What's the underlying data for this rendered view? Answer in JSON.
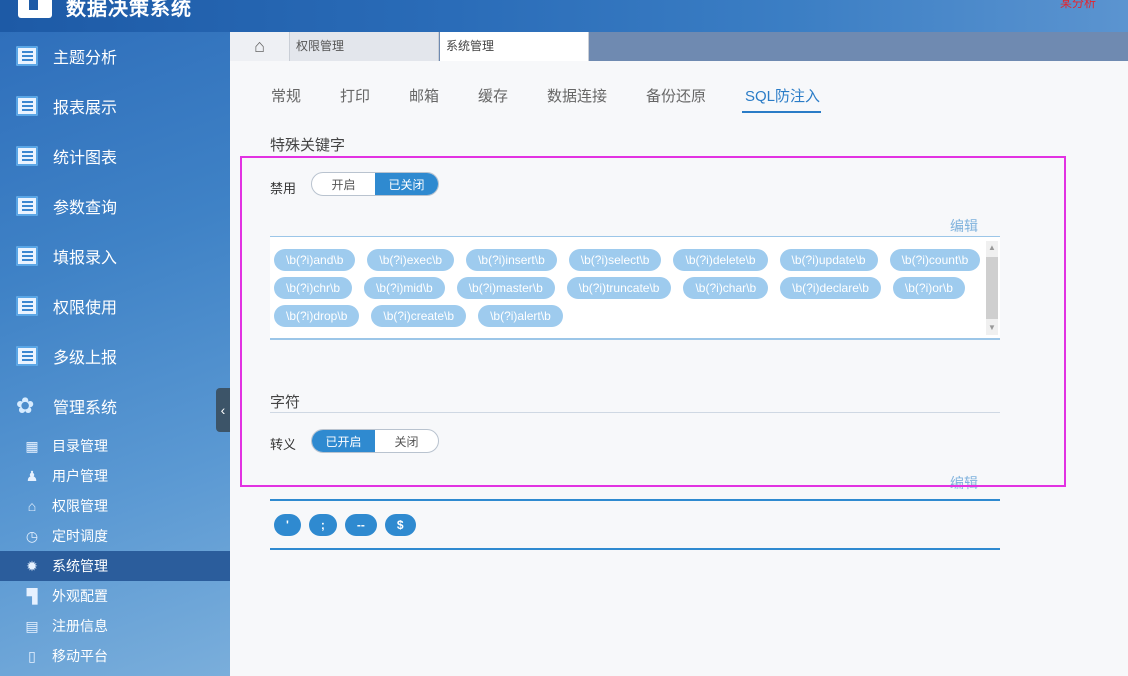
{
  "app": {
    "title": "数据决策系统",
    "user_link": "某分析"
  },
  "sidebar": {
    "items": [
      {
        "label": "主题分析",
        "icon": "report-icon"
      },
      {
        "label": "报表展示",
        "icon": "report-icon"
      },
      {
        "label": "统计图表",
        "icon": "report-icon"
      },
      {
        "label": "参数查询",
        "icon": "report-icon"
      },
      {
        "label": "填报录入",
        "icon": "report-icon"
      },
      {
        "label": "权限使用",
        "icon": "report-icon"
      },
      {
        "label": "多级上报",
        "icon": "report-icon"
      },
      {
        "label": "管理系统",
        "icon": "gear-icon"
      }
    ],
    "sub_items": [
      {
        "label": "目录管理",
        "icon": "directory-icon",
        "glyph": "▦"
      },
      {
        "label": "用户管理",
        "icon": "user-icon",
        "glyph": "♟"
      },
      {
        "label": "权限管理",
        "icon": "lock-icon",
        "glyph": "⌂"
      },
      {
        "label": "定时调度",
        "icon": "clock-icon",
        "glyph": "◷"
      },
      {
        "label": "系统管理",
        "icon": "settings-icon",
        "glyph": "✹",
        "active": true
      },
      {
        "label": "外观配置",
        "icon": "paint-roller-icon",
        "glyph": "▜"
      },
      {
        "label": "注册信息",
        "icon": "register-icon",
        "glyph": "▤"
      },
      {
        "label": "移动平台",
        "icon": "mobile-icon",
        "glyph": "▯"
      }
    ]
  },
  "tabs": [
    {
      "label": "权限管理"
    },
    {
      "label": "系统管理",
      "active": true
    }
  ],
  "subtabs": [
    "常规",
    "打印",
    "邮箱",
    "缓存",
    "数据连接",
    "备份还原",
    "SQL防注入"
  ],
  "keywords_section": {
    "title": "特殊关键字",
    "field_label": "禁用",
    "toggle_off": "开启",
    "toggle_on": "已关闭",
    "edit": "编辑",
    "keywords": [
      "\\b(?i)and\\b",
      "\\b(?i)exec\\b",
      "\\b(?i)insert\\b",
      "\\b(?i)select\\b",
      "\\b(?i)delete\\b",
      "\\b(?i)update\\b",
      "\\b(?i)count\\b",
      "\\b(?i)chr\\b",
      "\\b(?i)mid\\b",
      "\\b(?i)master\\b",
      "\\b(?i)truncate\\b",
      "\\b(?i)char\\b",
      "\\b(?i)declare\\b",
      "\\b(?i)or\\b",
      "\\b(?i)drop\\b",
      "\\b(?i)create\\b",
      "\\b(?i)alert\\b"
    ]
  },
  "chars_section": {
    "title": "字符",
    "field_label": "转义",
    "toggle_on": "已开启",
    "toggle_off": "关闭",
    "edit": "编辑",
    "chars": [
      "'",
      ";",
      "--",
      "$"
    ]
  },
  "colors": {
    "accent": "#2f8ad0",
    "highlight": "#e232e2",
    "chip": "#9ecbee"
  }
}
